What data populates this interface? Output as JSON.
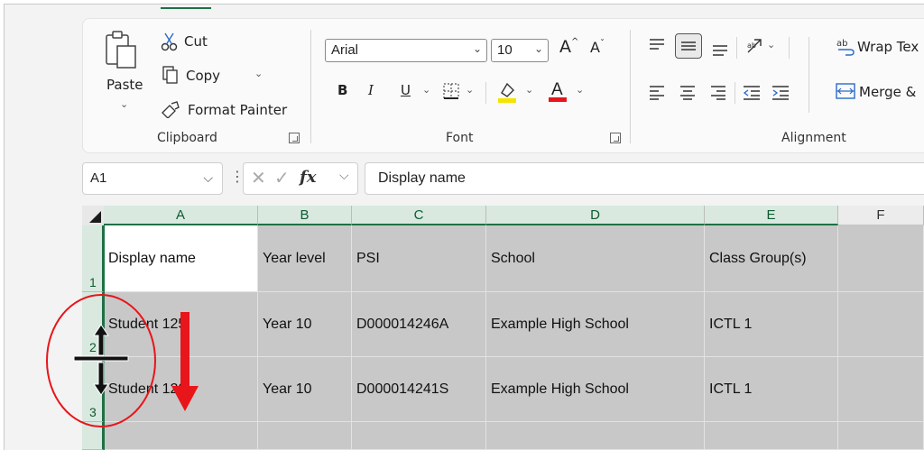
{
  "ribbon": {
    "clipboard": {
      "paste_label": "Paste",
      "cut_label": "Cut",
      "copy_label": "Copy",
      "format_painter_label": "Format Painter",
      "group_label": "Clipboard"
    },
    "font": {
      "font_name": "Arial",
      "font_size": "10",
      "group_label": "Font",
      "bold": "B",
      "italic": "I",
      "underline": "U",
      "font_color_bar": "#e8151b",
      "highlight_color_bar": "#f5e400"
    },
    "alignment": {
      "wrap_text_label": "Wrap Tex",
      "merge_label": "Merge &",
      "group_label": "Alignment"
    }
  },
  "formula_bar": {
    "name_box": "A1",
    "fx": "fx",
    "value": "Display name"
  },
  "grid": {
    "columns": [
      "A",
      "B",
      "C",
      "D",
      "E",
      "F"
    ],
    "rows": [
      {
        "num": "1",
        "cells": [
          "Display name",
          "Year level",
          "PSI",
          "School",
          "Class Group(s)",
          ""
        ]
      },
      {
        "num": "2",
        "cells": [
          "Student 125",
          "Year 10",
          "D000014246A",
          "Example High School",
          "ICTL 1",
          ""
        ]
      },
      {
        "num": "3",
        "cells": [
          "Student 120",
          "Year 10",
          "D000014241S",
          "Example High School",
          "ICTL 1",
          ""
        ]
      }
    ]
  },
  "colors": {
    "accent_green": "#1e7145",
    "annotation_red": "#e8151b",
    "cell_gray": "#c8c8c8"
  }
}
